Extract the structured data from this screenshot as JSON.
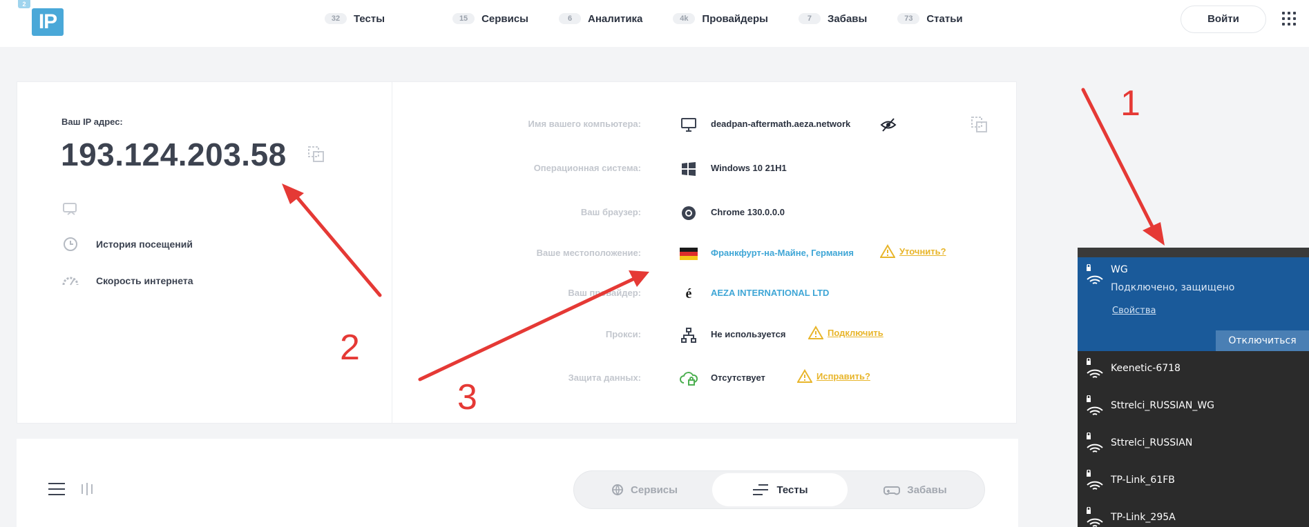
{
  "logo": {
    "badge": "2",
    "text": "IP"
  },
  "nav": [
    {
      "count": "32",
      "label": "Тесты"
    },
    {
      "count": "15",
      "label": "Сервисы"
    },
    {
      "count": "6",
      "label": "Аналитика"
    },
    {
      "count": "4k",
      "label": "Провайдеры"
    },
    {
      "count": "7",
      "label": "Забавы"
    },
    {
      "count": "73",
      "label": "Статьи"
    }
  ],
  "header": {
    "login_label": "Войти"
  },
  "ip": {
    "label": "Ваш IP адрес:",
    "value": "193.124.203.58",
    "links": [
      {
        "label": "История посещений",
        "icon": "history-icon"
      },
      {
        "label": "Скорость интернета",
        "icon": "speedometer-icon"
      }
    ]
  },
  "info": {
    "computer_label": "Имя вашего компьютера:",
    "computer_value": "deadpan-aftermath.aeza.network",
    "os_label": "Операционная система:",
    "os_value": "Windows 10 21H1",
    "browser_label": "Ваш браузер:",
    "browser_value": "Chrome 130.0.0.0",
    "location_label": "Ваше местоположение:",
    "location_value": "Франкфурт-на-Майне, Германия",
    "location_action": "Уточнить?",
    "provider_label": "Ваш провайдер:",
    "provider_value": "AEZA INTERNATIONAL LTD",
    "proxy_label": "Прокси:",
    "proxy_value": "Не используется",
    "proxy_action": "Подключить",
    "privacy_label": "Защита данных:",
    "privacy_value": "Отсутствует",
    "privacy_action": "Исправить?"
  },
  "tabs": [
    {
      "label": "Сервисы",
      "icon": "globe-icon",
      "active": false
    },
    {
      "label": "Тесты",
      "icon": "sliders-icon",
      "active": true
    },
    {
      "label": "Забавы",
      "icon": "gamepad-icon",
      "active": false
    }
  ],
  "annotations": {
    "one": "1",
    "two": "2",
    "three": "3"
  },
  "colors": {
    "accent": "#4aa8d8",
    "warning": "#e8b52a",
    "annotation": "#e53935",
    "wifi_active": "#1a5a9a"
  },
  "wifi": {
    "connected": {
      "name": "WG",
      "status": "Подключено, защищено",
      "properties": "Свойства",
      "disconnect": "Отключиться"
    },
    "networks": [
      {
        "name": "Keenetic-6718"
      },
      {
        "name": "Sttrelci_RUSSIAN_WG"
      },
      {
        "name": "Sttrelci_RUSSIAN"
      },
      {
        "name": "TP-Link_61FB"
      },
      {
        "name": "TP-Link_295A"
      }
    ]
  }
}
